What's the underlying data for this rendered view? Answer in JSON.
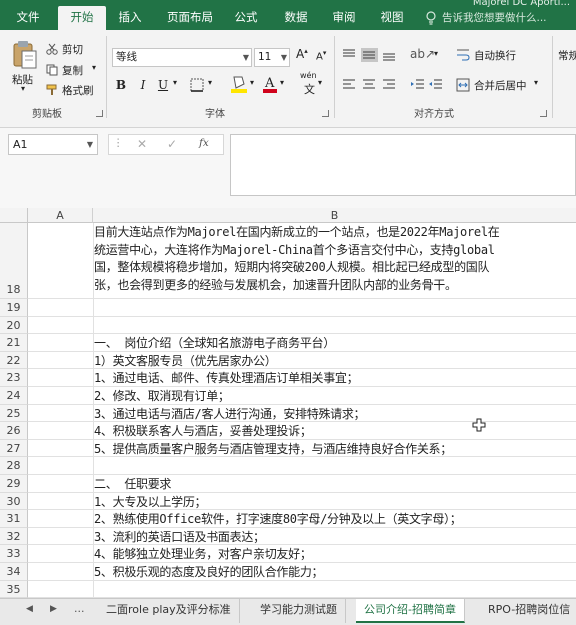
{
  "window": {
    "title": "Majorel DC Aporti..."
  },
  "menu": {
    "tabs": [
      "文件",
      "开始",
      "插入",
      "页面布局",
      "公式",
      "数据",
      "审阅",
      "视图"
    ],
    "tell_me": "告诉我您想要做什么..."
  },
  "ribbon": {
    "clipboard": {
      "paste": "粘贴",
      "cut": "剪切",
      "copy": "复制",
      "format_painter": "格式刷",
      "group_label": "剪贴板"
    },
    "font": {
      "name": "等线",
      "size": "11",
      "bold": "B",
      "italic": "I",
      "underline": "U",
      "phonetic": "wén",
      "group_label": "字体",
      "fill_color": "#FFE600",
      "font_color": "#D0021B"
    },
    "alignment": {
      "wrap_text": "自动换行",
      "merge_center": "合并后居中",
      "group_label": "对齐方式"
    },
    "number": {
      "format": "常规"
    }
  },
  "formula_bar": {
    "name_box": "A1",
    "fx": "fx",
    "value": ""
  },
  "grid": {
    "columns": [
      "A",
      "B"
    ],
    "rows": [
      {
        "num": "18",
        "lines": [
          "目前大连站点作为Majorel在国内新成立的一个站点，也是2022年Majorel在",
          "统运营中心，大连将作为Majorel-China首个多语言交付中心，支持global",
          "国，整体规模将稳步增加，短期内将突破200人规模。相比起已经成型的国队",
          "张，也会得到更多的经验与发展机会，加速晋升团队内部的业务骨干。"
        ]
      },
      {
        "num": "19",
        "lines": [
          ""
        ]
      },
      {
        "num": "20",
        "lines": [
          ""
        ]
      },
      {
        "num": "21",
        "lines": [
          "一、 岗位介绍（全球知名旅游电子商务平台）"
        ]
      },
      {
        "num": "22",
        "lines": [
          "1）英文客服专员（优先居家办公）"
        ]
      },
      {
        "num": "23",
        "lines": [
          "1、通过电话、邮件、传真处理酒店订单相关事宜；"
        ]
      },
      {
        "num": "24",
        "lines": [
          "2、修改、取消现有订单；"
        ]
      },
      {
        "num": "25",
        "lines": [
          "3、通过电话与酒店/客人进行沟通，安排特殊请求；"
        ]
      },
      {
        "num": "26",
        "lines": [
          "4、积极联系客人与酒店，妥善处理投诉；"
        ]
      },
      {
        "num": "27",
        "lines": [
          "5、提供高质量客户服务与酒店管理支持，与酒店维持良好合作关系；"
        ]
      },
      {
        "num": "28",
        "lines": [
          ""
        ]
      },
      {
        "num": "29",
        "lines": [
          "二、 任职要求"
        ]
      },
      {
        "num": "30",
        "lines": [
          "1、大专及以上学历；"
        ]
      },
      {
        "num": "31",
        "lines": [
          "2、熟练使用Office软件，打字速度80字母/分钟及以上（英文字母）；"
        ]
      },
      {
        "num": "32",
        "lines": [
          "3、流利的英语口语及书面表达；"
        ]
      },
      {
        "num": "33",
        "lines": [
          "4、能够独立处理业务，对客户亲切友好；"
        ]
      },
      {
        "num": "34",
        "lines": [
          "5、积极乐观的态度及良好的团队合作能力；"
        ]
      },
      {
        "num": "35",
        "lines": [
          ""
        ]
      }
    ]
  },
  "sheets": {
    "nav": [
      "◀",
      "▶",
      "..."
    ],
    "tabs": [
      "二面role play及评分标准",
      "学习能力测试题",
      "公司介绍-招聘简章",
      "RPO-招聘岗位信"
    ],
    "active_index": 2
  }
}
